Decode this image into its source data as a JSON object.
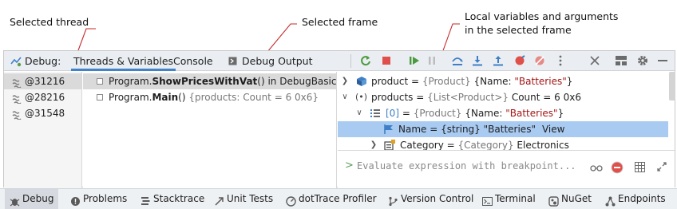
{
  "annotations": {
    "selected_thread": "Selected thread",
    "selected_frame": "Selected frame",
    "locals_line1": "Local variables and arguments",
    "locals_line2": "in the selected frame"
  },
  "debug_header": {
    "label": "Debug:",
    "tabs": [
      "Threads & Variables",
      "Console",
      "Debug Output"
    ],
    "selected_tab": "Threads & Variables"
  },
  "toolbar": {
    "icons": [
      "rerun-icon",
      "stop-icon",
      "resume-icon",
      "pause-icon",
      "step-over-icon",
      "step-into-icon",
      "step-out-icon",
      "run-to-cursor-icon",
      "mute-breakpoints-icon",
      "more-icon",
      "close-icon",
      "layout-icon",
      "settings-icon",
      "minimize-icon"
    ]
  },
  "threads": [
    {
      "name": "@31216",
      "selected": true
    },
    {
      "name": "@28216",
      "selected": false
    },
    {
      "name": "@31548",
      "selected": false
    }
  ],
  "frames": [
    {
      "prefix": "Program.",
      "method": "ShowPricesWithVat",
      "suffix": "() in DebugBasics, Debug",
      "selected": true
    },
    {
      "prefix": "Program.",
      "method": "Main",
      "suffix": "() ",
      "extra": "{products: Count = 6 0x6}",
      "selected": false
    }
  ],
  "variables": [
    {
      "name": "product",
      "eq": " = ",
      "type": "{Product}",
      "value": " {Name: ",
      "str": "\"Batteries\"",
      "close": "}",
      "expand": "collapsed",
      "icon": "object-icon"
    },
    {
      "name": "products",
      "eq": " = ",
      "type": "{List<Product>}",
      "value": " Count = 6 0x6",
      "expand": "expanded",
      "icon": "local-variable-icon"
    },
    {
      "name": "[0]",
      "eq": " = ",
      "type": "{Product}",
      "value": " {Name: ",
      "str": "\"Batteries\"",
      "close": "}",
      "expand": "expanded",
      "icon": "list-item-icon"
    },
    {
      "name": "Name",
      "eq": " = ",
      "type": "{string}",
      "value": " ",
      "str": "\"Batteries\"",
      "link": "View",
      "expand": "none",
      "icon": "property-icon",
      "selected": true
    },
    {
      "name": "Category",
      "eq": " = ",
      "type": "{Category}",
      "value": " Electronics",
      "expand": "collapsed",
      "icon": "enum-icon"
    }
  ],
  "evaluate": {
    "prompt": ">",
    "placeholder": "Evaluate expression with breakpoint..."
  },
  "bottom_bar": [
    {
      "label": "Debug",
      "icon": "debug-icon",
      "selected": true
    },
    {
      "label": "Problems",
      "icon": "problems-icon"
    },
    {
      "label": "Stacktrace",
      "icon": "stacktrace-icon"
    },
    {
      "label": "Unit Tests",
      "icon": "unit-tests-icon"
    },
    {
      "label": "dotTrace Profiler",
      "icon": "dottrace-icon"
    },
    {
      "label": "Version Control",
      "icon": "version-control-icon"
    },
    {
      "label": "Terminal",
      "icon": "terminal-icon"
    },
    {
      "label": "NuGet",
      "icon": "nuget-icon"
    },
    {
      "label": "Endpoints",
      "icon": "endpoints-icon"
    }
  ],
  "colors": {
    "accent": "#4083c9",
    "selection": "#a9cbf2",
    "string": "#a31515",
    "type_gray": "#787878"
  }
}
